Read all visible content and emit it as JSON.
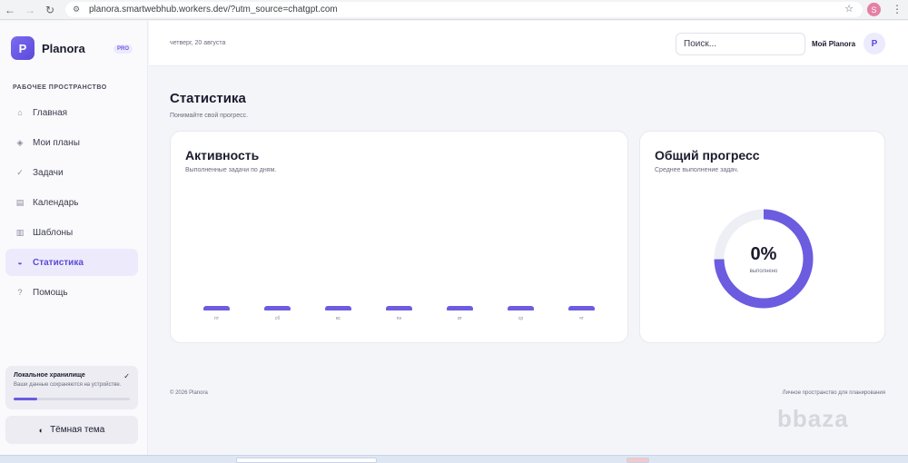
{
  "browser": {
    "url": "planora.smartwebhub.workers.dev/?utm_source=chatgpt.com",
    "profile_initial": "S"
  },
  "sidebar": {
    "brand_initial": "P",
    "brand_name": "Planora",
    "badge": "PRO",
    "section_title": "РАБОЧЕЕ ПРОСТРАНСТВО",
    "items": [
      {
        "label": "Главная",
        "icon": "home-icon",
        "active": false
      },
      {
        "label": "Мои планы",
        "icon": "diamond-icon",
        "active": false
      },
      {
        "label": "Задачи",
        "icon": "check-icon",
        "active": false
      },
      {
        "label": "Календарь",
        "icon": "calendar-icon",
        "active": false
      },
      {
        "label": "Шаблоны",
        "icon": "template-icon",
        "active": false
      },
      {
        "label": "Статистика",
        "icon": "chart-icon",
        "active": true
      },
      {
        "label": "Помощь",
        "icon": "help-icon",
        "active": false
      }
    ],
    "storage": {
      "title": "Локальное хранилище",
      "description": "Ваши данные сохраняются на устройстве.",
      "fill_fraction": 0.2
    },
    "theme_label": "Тёмная тема"
  },
  "topbar": {
    "date": "четверг, 20 августа",
    "search_placeholder": "Поиск...",
    "user_name": "Мой Planora",
    "user_initial": "P"
  },
  "main": {
    "title": "Статистика",
    "subtitle": "Понимайте свой прогресс.",
    "activity": {
      "title": "Активность",
      "subtitle": "Выполненные задачи по дням.",
      "day_labels": [
        "пт",
        "сб",
        "вс",
        "пн",
        "вт",
        "ср",
        "чт"
      ]
    },
    "progress": {
      "title": "Общий прогресс",
      "subtitle": "Среднее выполнение задач.",
      "value_label": "0%",
      "caption": "выполнено"
    }
  },
  "chart_data": {
    "type": "bar",
    "categories": [
      "пт",
      "сб",
      "вс",
      "пн",
      "вт",
      "ср",
      "чт"
    ],
    "values": [
      0,
      0,
      0,
      0,
      0,
      0,
      0
    ]
  },
  "footer": {
    "left": "© 2026 Planora",
    "right": "Личное пространство для планирования"
  },
  "watermark": "bbaza",
  "colors": {
    "accent": "#6b5ce0",
    "accent_light": "#edeafc",
    "ring_track": "#eeeff4",
    "ring_fill": "#6b5ce0"
  }
}
